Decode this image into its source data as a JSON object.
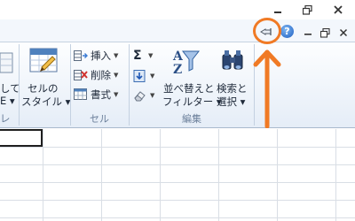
{
  "ribbon": {
    "partial_left_labels": [
      "して",
      "E ▾",
      "レ"
    ],
    "styles_group": {
      "cell_style_line1": "セルの",
      "cell_style_line2": "スタイル ▾"
    },
    "cells_group": {
      "insert": "挿入",
      "delete": "削除",
      "format": "書式",
      "label": "セル"
    },
    "editing_group": {
      "sum_symbol": "Σ",
      "sort_filter_line1": "並べ替えと",
      "sort_filter_line2": "フィルター ▾",
      "find_select_line1": "検索と",
      "find_select_line2": "選択 ▾",
      "label": "編集"
    },
    "help_glyph": "?"
  },
  "colors": {
    "annotation": "#f07a25",
    "ribbon_bg": "#e5edf7",
    "group_label": "#6b7f9a"
  }
}
